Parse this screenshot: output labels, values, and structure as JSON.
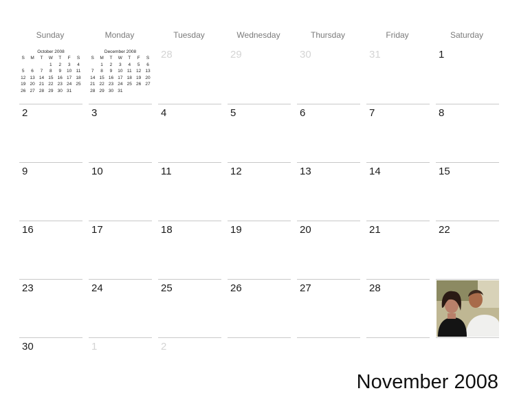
{
  "calendar": {
    "title": "November 2008",
    "weekdays": [
      "Sunday",
      "Monday",
      "Tuesday",
      "Wednesday",
      "Thursday",
      "Friday",
      "Saturday"
    ],
    "weeks": [
      [
        {
          "d": "",
          "o": true
        },
        {
          "d": "",
          "o": true
        },
        {
          "d": "28",
          "o": true
        },
        {
          "d": "29",
          "o": true
        },
        {
          "d": "30",
          "o": true
        },
        {
          "d": "31",
          "o": true
        },
        {
          "d": "1",
          "o": false
        }
      ],
      [
        {
          "d": "2",
          "o": false
        },
        {
          "d": "3",
          "o": false
        },
        {
          "d": "4",
          "o": false
        },
        {
          "d": "5",
          "o": false
        },
        {
          "d": "6",
          "o": false
        },
        {
          "d": "7",
          "o": false
        },
        {
          "d": "8",
          "o": false
        }
      ],
      [
        {
          "d": "9",
          "o": false
        },
        {
          "d": "10",
          "o": false
        },
        {
          "d": "11",
          "o": false
        },
        {
          "d": "12",
          "o": false
        },
        {
          "d": "13",
          "o": false
        },
        {
          "d": "14",
          "o": false
        },
        {
          "d": "15",
          "o": false
        }
      ],
      [
        {
          "d": "16",
          "o": false
        },
        {
          "d": "17",
          "o": false
        },
        {
          "d": "18",
          "o": false
        },
        {
          "d": "19",
          "o": false
        },
        {
          "d": "20",
          "o": false
        },
        {
          "d": "21",
          "o": false
        },
        {
          "d": "22",
          "o": false
        }
      ],
      [
        {
          "d": "23",
          "o": false
        },
        {
          "d": "24",
          "o": false
        },
        {
          "d": "25",
          "o": false
        },
        {
          "d": "26",
          "o": false
        },
        {
          "d": "27",
          "o": false
        },
        {
          "d": "28",
          "o": false
        },
        {
          "d": "",
          "o": false
        }
      ],
      [
        {
          "d": "30",
          "o": false
        },
        {
          "d": "1",
          "o": true
        },
        {
          "d": "2",
          "o": true
        },
        {
          "d": "",
          "o": true
        },
        {
          "d": "",
          "o": true
        },
        {
          "d": "",
          "o": true
        },
        {
          "d": "",
          "o": true
        }
      ]
    ]
  },
  "mini_calendars": [
    {
      "title": "October 2008",
      "header": [
        "S",
        "M",
        "T",
        "W",
        "T",
        "F",
        "S"
      ],
      "rows": [
        [
          "",
          "",
          "",
          "1",
          "2",
          "3",
          "4"
        ],
        [
          "5",
          "6",
          "7",
          "8",
          "9",
          "10",
          "11"
        ],
        [
          "12",
          "13",
          "14",
          "15",
          "16",
          "17",
          "18"
        ],
        [
          "19",
          "20",
          "21",
          "22",
          "23",
          "24",
          "25"
        ],
        [
          "26",
          "27",
          "28",
          "29",
          "30",
          "31",
          ""
        ]
      ]
    },
    {
      "title": "December 2008",
      "header": [
        "S",
        "M",
        "T",
        "W",
        "T",
        "F",
        "S"
      ],
      "rows": [
        [
          "",
          "1",
          "2",
          "3",
          "4",
          "5",
          "6"
        ],
        [
          "7",
          "8",
          "9",
          "10",
          "11",
          "12",
          "13"
        ],
        [
          "14",
          "15",
          "16",
          "17",
          "18",
          "19",
          "20"
        ],
        [
          "21",
          "22",
          "23",
          "24",
          "25",
          "26",
          "27"
        ],
        [
          "28",
          "29",
          "30",
          "31",
          "",
          "",
          ""
        ]
      ]
    }
  ],
  "photo": {
    "subject": "couple-photo"
  }
}
